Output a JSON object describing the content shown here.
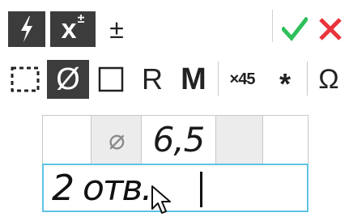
{
  "toolbar_top": {
    "items": [
      {
        "name": "lightning-button",
        "icon": "lightning-icon",
        "active": true
      },
      {
        "name": "x-superscript-button",
        "label_base": "x",
        "label_sup": "±",
        "active": true
      },
      {
        "name": "plus-minus-button",
        "label": "±"
      },
      {
        "name": "confirm-button",
        "icon": "checkmark-icon"
      },
      {
        "name": "cancel-button",
        "icon": "close-icon"
      }
    ],
    "colors": {
      "confirm": "#2fbf5a",
      "cancel": "#e8343a",
      "dark": "#3c3c3c"
    }
  },
  "toolbar_symbols": {
    "items": [
      {
        "name": "dashed-square-button",
        "icon": "dashed-square-icon"
      },
      {
        "name": "diameter-button",
        "label": "Ø",
        "active": true
      },
      {
        "name": "square-button",
        "icon": "square-icon"
      },
      {
        "name": "radius-button",
        "label": "R"
      },
      {
        "name": "metric-button",
        "label": "M"
      },
      {
        "name": "chamfer-button",
        "label": "×45"
      },
      {
        "name": "asterisk-button",
        "label": "*"
      },
      {
        "name": "omega-button",
        "label": "Ω"
      }
    ]
  },
  "dimension_table": {
    "diameter_symbol": "⌀",
    "value": "6,5"
  },
  "text_input": {
    "value": "2 отв."
  },
  "accent": {
    "input_border": "#5ec3e6"
  }
}
